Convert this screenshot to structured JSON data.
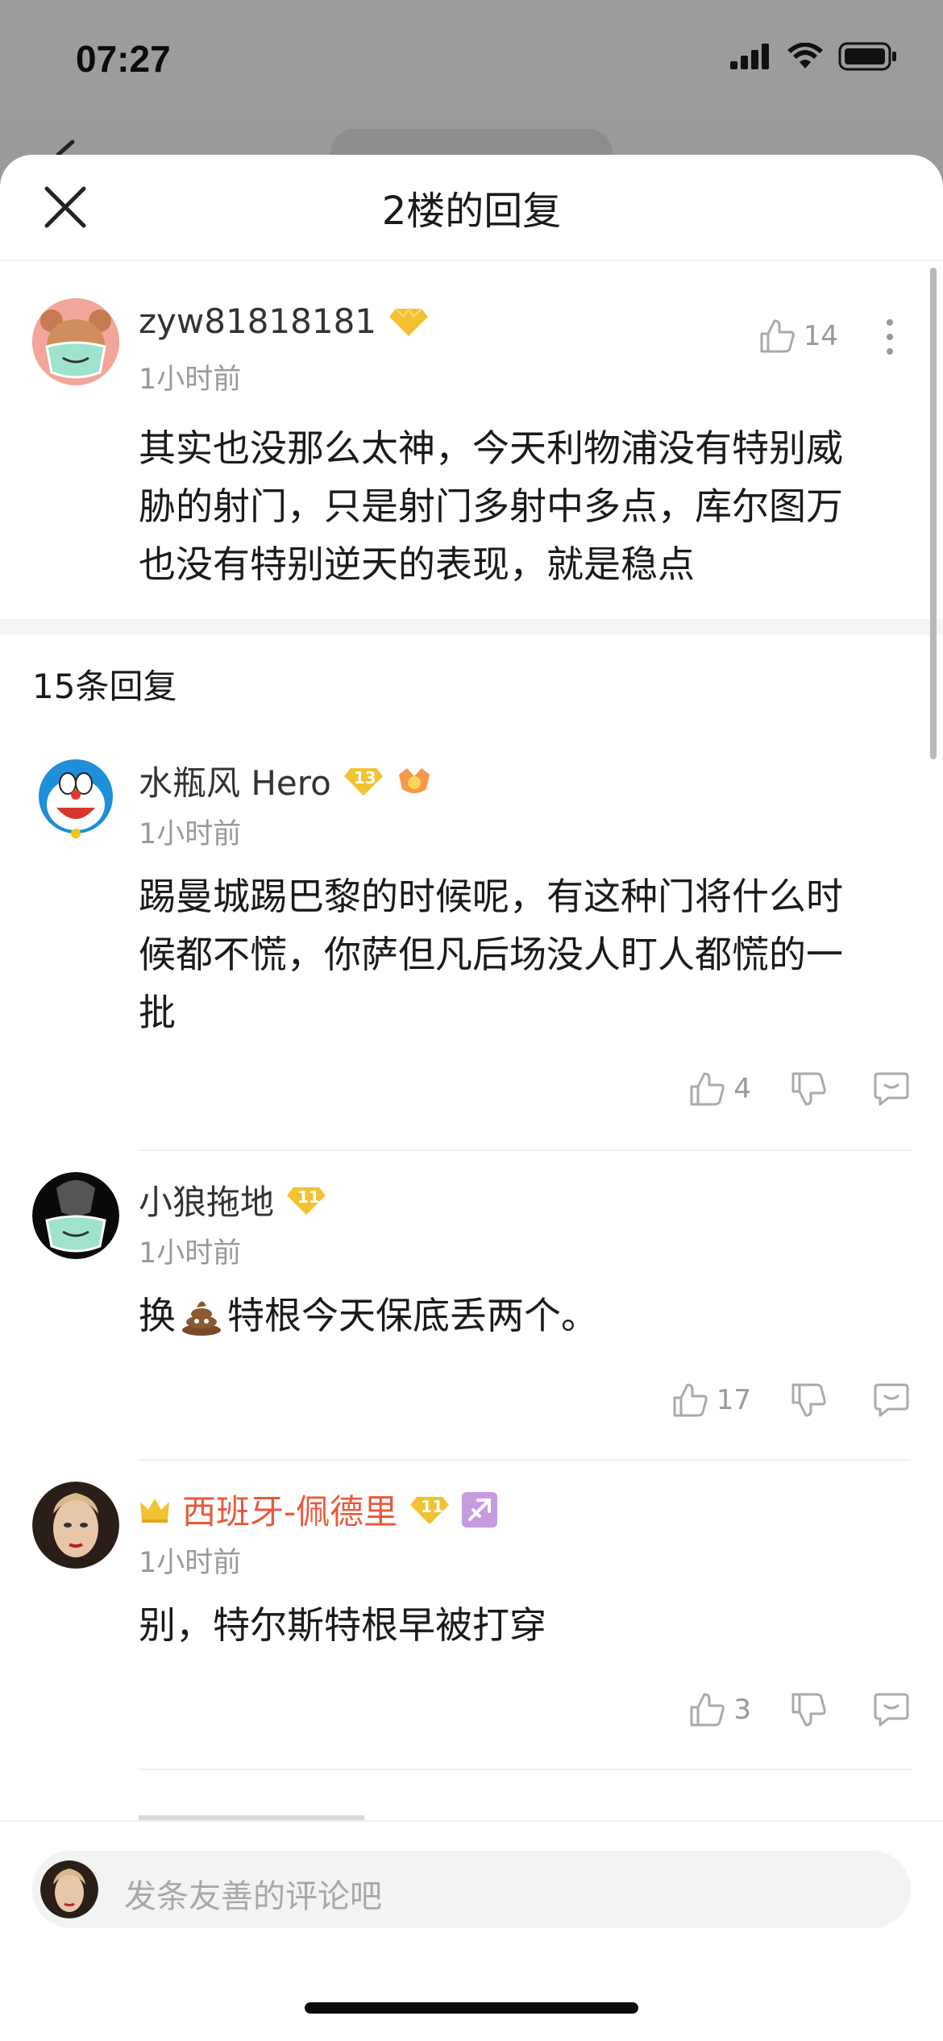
{
  "status": {
    "time": "07:27"
  },
  "sheet": {
    "title": "2楼的回复"
  },
  "main_comment": {
    "username": "zyw81818181",
    "badge_level": "",
    "time": "1小时前",
    "likes": "14",
    "text_lines": [
      "其实也没那么太神，今天利物浦没有特别威",
      "胁的射门，只是射门多射中多点，库尔图万",
      "也没有特别逆天的表现，就是稳点"
    ]
  },
  "replies_header": "15条回复",
  "replies": [
    {
      "username": "水瓶风 Hero",
      "badge_level": "13",
      "time": "1小时前",
      "text_lines": [
        "踢曼城踢巴黎的时候呢，有这种门将什么时",
        "候都不慌，你萨但凡后场没人盯人都慌的一",
        "批"
      ],
      "likes": "4"
    },
    {
      "username": "小狼拖地",
      "badge_level": "11",
      "time": "1小时前",
      "text_before": "换",
      "text_after": "特根今天保底丢两个。",
      "likes": "17"
    },
    {
      "username": "西班牙-佩德里",
      "badge_level": "11",
      "time": "1小时前",
      "text_lines": [
        "别，特尔斯特根早被打穿"
      ],
      "likes": "3",
      "name_color": "#e8593a"
    }
  ],
  "input": {
    "placeholder": "发条友善的评论吧"
  },
  "colors": {
    "accent_name": "#e8593a",
    "badge_gold": "#f2c230",
    "secondary_text": "#999999"
  },
  "icons": [
    "close-icon",
    "like-icon",
    "dislike-icon",
    "reply-icon",
    "more-icon",
    "crown-icon",
    "poop-emoji-icon",
    "sagittarius-icon"
  ]
}
